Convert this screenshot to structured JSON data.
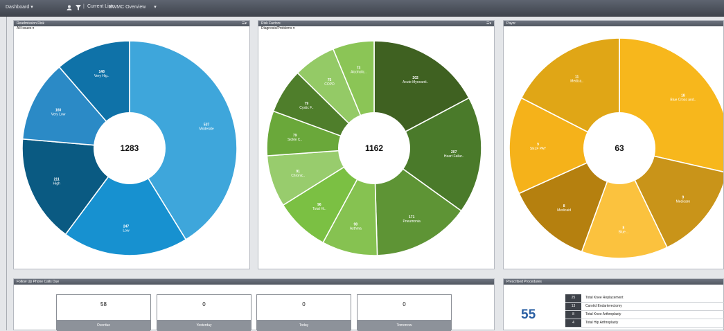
{
  "topbar": {
    "dashboard_label": "Dashboard",
    "current_list_label": "Current List:",
    "current_list_value": "BWMC Overview"
  },
  "panels": {
    "readmission": {
      "title": "Readmission Risk",
      "filter": "All Issues"
    },
    "risk_factors": {
      "title": "Risk Factors",
      "filter": "Diagnosis/Problems"
    },
    "payor": {
      "title": "Payor"
    },
    "followup": {
      "title": "Follow Up Phone Calls Due"
    },
    "procedures": {
      "title": "Prescribed Procedures",
      "count": "55"
    }
  },
  "chart_data": [
    {
      "type": "pie",
      "title": "Readmission Risk",
      "total": "1283",
      "slices": [
        {
          "label": "Moderate",
          "value": 537,
          "color": "#3ea6db"
        },
        {
          "label": "Low",
          "value": 247,
          "color": "#1791d0"
        },
        {
          "label": "High",
          "value": 211,
          "color": "#0a5a82"
        },
        {
          "label": "Very Low",
          "value": 160,
          "color": "#2b8ac6"
        },
        {
          "label": "Very Hig..",
          "value": 148,
          "color": "#0f72a8"
        }
      ]
    },
    {
      "type": "pie",
      "title": "Risk Factors",
      "total": "1162",
      "slices": [
        {
          "label": "Acute Myocardi..",
          "value": 202,
          "color": "#3f6121"
        },
        {
          "label": "Heart Failur..",
          "value": 207,
          "color": "#4a7a2a"
        },
        {
          "label": "Pneumonia",
          "value": 171,
          "color": "#5e9435"
        },
        {
          "label": "Asthma",
          "value": 98,
          "color": "#86c251"
        },
        {
          "label": "Total Hi..",
          "value": 96,
          "color": "#7bc043"
        },
        {
          "label": "Chronic..",
          "value": 91,
          "color": "#98cc6d"
        },
        {
          "label": "Sickle C..",
          "value": 79,
          "color": "#6aa83a"
        },
        {
          "label": "Cystic F..",
          "value": 79,
          "color": "#4f7e2b"
        },
        {
          "label": "COPD",
          "value": 75,
          "color": "#94ca66"
        },
        {
          "label": "Alcoholic..",
          "value": 73,
          "color": "#8bc556"
        }
      ]
    },
    {
      "type": "pie",
      "title": "Payor",
      "total": "63",
      "slices": [
        {
          "label": "Blue Cross and..",
          "value": 18,
          "color": "#f7b71c"
        },
        {
          "label": "Medicare",
          "value": 9,
          "color": "#c99419"
        },
        {
          "label": "Blue ..",
          "value": 8,
          "color": "#fbc23e"
        },
        {
          "label": "Medicaid",
          "value": 8,
          "color": "#b5800f"
        },
        {
          "label": "SELF PAY",
          "value": 9,
          "color": "#f5b21a"
        },
        {
          "label": "Medica..",
          "value": 11,
          "color": "#e0a616"
        }
      ]
    }
  ],
  "followup": {
    "cards": [
      {
        "value": "58",
        "label": "Overdue"
      },
      {
        "value": "0",
        "label": "Yesterday"
      },
      {
        "value": "0",
        "label": "Today"
      },
      {
        "value": "0",
        "label": "Tomorrow"
      }
    ]
  },
  "procedures": {
    "rows": [
      {
        "count": "25",
        "name": "Total Knee Replacement"
      },
      {
        "count": "13",
        "name": "Carotid Endarterectomy"
      },
      {
        "count": "8",
        "name": "Total Knee Arthroplasty"
      },
      {
        "count": "4",
        "name": "Total Hip Arthroplasty"
      }
    ]
  }
}
